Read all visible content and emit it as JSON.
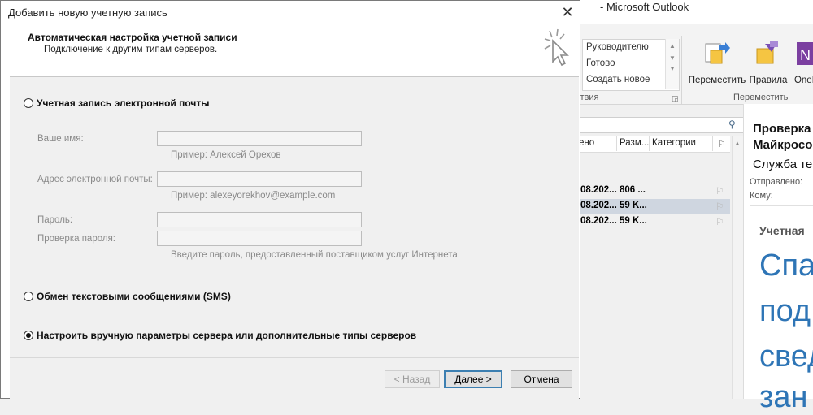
{
  "outlook": {
    "window_title": "Microsoft Outlook",
    "title_partial": "-  Microsoft Outlook",
    "quick_steps": {
      "items": [
        "Руководителю",
        "Готово",
        "Создать новое"
      ],
      "group_label": "ствия"
    },
    "ribbon": {
      "move_button": "Переместить",
      "rules_button": "Правила",
      "onenote_button": "OneN",
      "move_group": "Переместить"
    },
    "list": {
      "columns": [
        "ено",
        "Разм...",
        "Категории"
      ],
      "rows": [
        {
          "date": "08.202...",
          "size": "806 ..."
        },
        {
          "date": "08.202...",
          "size": "59 K..."
        },
        {
          "date": "08.202...",
          "size": "59 K..."
        }
      ]
    },
    "reading": {
      "subject_line1": "Проверка",
      "subject_line2": "Майкросо",
      "from": "Служба те",
      "sent_label": "Отправлено:",
      "to_label": "Кому:",
      "sent_value": "",
      "to_value": "",
      "account_heading": "Учетная",
      "body_lines": [
        "Спа",
        "под",
        "свед",
        "зан"
      ]
    }
  },
  "dialog": {
    "title": "Добавить новую учетную запись",
    "close": "✕",
    "header_title": "Автоматическая настройка учетной записи",
    "header_subtitle": "Подключение к другим типам серверов.",
    "options": {
      "email": "Учетная запись электронной почты",
      "sms": "Обмен текстовыми сообщениями (SMS)",
      "manual": "Настроить вручную параметры сервера или дополнительные типы серверов"
    },
    "fields": {
      "name_label": "Ваше имя:",
      "name_hint": "Пример: Алексей Орехов",
      "email_label": "Адрес электронной почты:",
      "email_hint": "Пример: alexeyorekhov@example.com",
      "password_label": "Пароль:",
      "password_confirm_label": "Проверка пароля:",
      "password_hint": "Введите пароль, предоставленный поставщиком услуг Интернета."
    },
    "buttons": {
      "back": "< Назад",
      "next": "Далее >",
      "cancel": "Отмена"
    }
  },
  "colors": {
    "accent_blue": "#2e75b6",
    "default_button_border": "#3c7fb1",
    "selected_row": "#cfd6e0"
  }
}
